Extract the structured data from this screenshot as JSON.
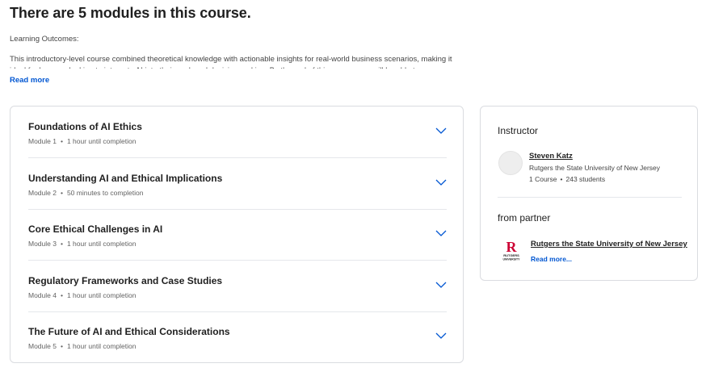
{
  "header": {
    "title": "There are 5 modules in this course."
  },
  "about": {
    "outcomes_label": "Learning Outcomes:",
    "intro_text": "This introductory-level course combined theoretical knowledge with actionable insights for real-world business scenarios, making it ideal for learners looking to integrate AI into their work and decision-making. By the end of this course, you will be able to understand and apply",
    "read_more": "Read more"
  },
  "modules": [
    {
      "title": "Foundations of AI Ethics",
      "number": "Module 1",
      "duration": "1 hour until completion"
    },
    {
      "title": "Understanding AI and Ethical Implications",
      "number": "Module 2",
      "duration": "50 minutes to completion"
    },
    {
      "title": "Core Ethical Challenges in AI",
      "number": "Module 3",
      "duration": "1 hour until completion"
    },
    {
      "title": "Regulatory Frameworks and Case Studies",
      "number": "Module 4",
      "duration": "1 hour until completion"
    },
    {
      "title": "The Future of AI and Ethical Considerations",
      "number": "Module 5",
      "duration": "1 hour until completion"
    }
  ],
  "meta_separator": "•",
  "instructor": {
    "section_title": "Instructor",
    "name": "Steven Katz",
    "university": "Rutgers the State University of New Jersey",
    "courses": "1 Course",
    "students": "243 students"
  },
  "partner": {
    "section_title": "from partner",
    "name": "Rutgers the State University of New Jersey",
    "read_more": "Read more...",
    "logo_letter": "R",
    "logo_text_line1": "RUTGERS",
    "logo_text_line2": "UNIVERSITY"
  },
  "colors": {
    "accent": "#0056d2",
    "rutgers_red": "#cc0033",
    "chevron": "#0056d2"
  },
  "icons": {
    "expand": "chevron-down-icon"
  }
}
